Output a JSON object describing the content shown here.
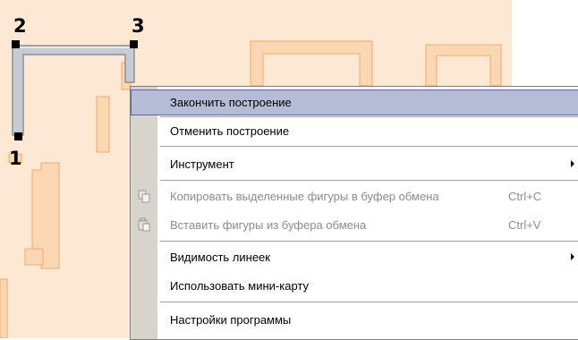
{
  "markers": {
    "point_1": "1",
    "point_2": "2",
    "point_3": "3"
  },
  "colors": {
    "background": "#fde8d4",
    "shape_fill": "#fbd7b3",
    "shape_stroke": "#f4a86a",
    "wall": "#c8ccd2",
    "wall_stroke": "#8a8f96"
  },
  "context_menu": {
    "items": [
      {
        "label": "Закончить построение",
        "highlighted": true
      },
      {
        "label": "Отменить построение"
      },
      {
        "label": "Инструмент",
        "submenu": true
      },
      {
        "label": "Копировать выделенные фигуры в буфер обмена",
        "shortcut": "Ctrl+C",
        "disabled": true,
        "icon": "copy-icon"
      },
      {
        "label": "Вставить фигуры из буфера обмена",
        "shortcut": "Ctrl+V",
        "disabled": true,
        "icon": "paste-icon"
      },
      {
        "label": "Видимость линеек",
        "submenu": true
      },
      {
        "label": "Использовать мини-карту"
      },
      {
        "label": "Настройки программы"
      }
    ]
  }
}
